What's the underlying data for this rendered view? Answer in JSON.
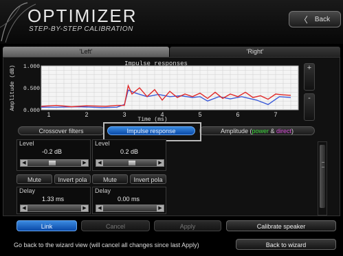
{
  "app": {
    "title": "OPTIMIZER",
    "subtitle": "STEP-BY-STEP CALIBRATION",
    "back_label": "Back"
  },
  "tabs": [
    {
      "label": "'Left'",
      "active": true
    },
    {
      "label": "'Right'",
      "active": false
    }
  ],
  "chart_data": {
    "type": "line",
    "title": "Impulse responses",
    "xlabel": "Time (ms)",
    "ylabel": "Amplitude (dB)",
    "x_ticks": [
      "1",
      "2",
      "3",
      "4",
      "5",
      "6",
      "7"
    ],
    "y_ticks": [
      "1.000",
      "0.500",
      "0.000"
    ],
    "xlim": [
      0.8,
      7.6
    ],
    "grid": true,
    "series": [
      {
        "color": "#3a5ad8",
        "points": [
          [
            0.8,
            0.06
          ],
          [
            1.2,
            0.06
          ],
          [
            1.8,
            0.07
          ],
          [
            2.4,
            0.05
          ],
          [
            2.8,
            0.06
          ],
          [
            3.0,
            0.12
          ],
          [
            3.1,
            0.45
          ],
          [
            3.3,
            0.38
          ],
          [
            3.6,
            0.3
          ],
          [
            3.9,
            0.35
          ],
          [
            4.2,
            0.3
          ],
          [
            4.5,
            0.32
          ],
          [
            4.8,
            0.28
          ],
          [
            5.0,
            0.3
          ],
          [
            5.2,
            0.2
          ],
          [
            5.5,
            0.3
          ],
          [
            5.8,
            0.25
          ],
          [
            6.1,
            0.3
          ],
          [
            6.5,
            0.22
          ],
          [
            6.8,
            0.12
          ],
          [
            7.1,
            0.3
          ],
          [
            7.4,
            0.28
          ]
        ]
      },
      {
        "color": "#e02828",
        "points": [
          [
            0.8,
            0.08
          ],
          [
            1.2,
            0.1
          ],
          [
            1.6,
            0.07
          ],
          [
            2.0,
            0.09
          ],
          [
            2.5,
            0.08
          ],
          [
            2.8,
            0.1
          ],
          [
            3.0,
            0.1
          ],
          [
            3.1,
            0.55
          ],
          [
            3.2,
            0.36
          ],
          [
            3.4,
            0.5
          ],
          [
            3.6,
            0.3
          ],
          [
            3.8,
            0.46
          ],
          [
            4.0,
            0.22
          ],
          [
            4.2,
            0.42
          ],
          [
            4.4,
            0.28
          ],
          [
            4.6,
            0.36
          ],
          [
            4.8,
            0.3
          ],
          [
            5.0,
            0.38
          ],
          [
            5.2,
            0.26
          ],
          [
            5.4,
            0.4
          ],
          [
            5.6,
            0.26
          ],
          [
            5.8,
            0.36
          ],
          [
            6.0,
            0.3
          ],
          [
            6.2,
            0.4
          ],
          [
            6.4,
            0.28
          ],
          [
            6.6,
            0.32
          ],
          [
            6.8,
            0.24
          ],
          [
            7.0,
            0.36
          ],
          [
            7.2,
            0.34
          ],
          [
            7.4,
            0.33
          ]
        ]
      }
    ]
  },
  "zoom": {
    "plus": "+",
    "minus": "-"
  },
  "modes": {
    "crossover": "Crossover filters",
    "impulse": "Impulse response",
    "amplitude_prefix": "Amplitude (",
    "amplitude_power": "power",
    "amplitude_amp": " & ",
    "amplitude_direct": "direct",
    "amplitude_suffix": ")"
  },
  "channels": [
    {
      "level_label": "Level",
      "level_value": "-0.2 dB",
      "level_fraction": 0.45,
      "mute": "Mute",
      "invert": "Invert pola",
      "delay_label": "Delay",
      "delay_value": "1.33 ms"
    },
    {
      "level_label": "Level",
      "level_value": "0.2 dB",
      "level_fraction": 0.55,
      "mute": "Mute",
      "invert": "Invert pola",
      "delay_label": "Delay",
      "delay_value": "0.00 ms"
    }
  ],
  "bottom": {
    "link": "Link",
    "cancel": "Cancel",
    "apply": "Apply",
    "calibrate": "Calibrate speaker",
    "status": "Go back to the wizard view (will cancel all changes since last Apply)",
    "wizard": "Back to wizard"
  },
  "colors": {
    "accent": "#1a6ad0",
    "series_blue": "#3a5ad8",
    "series_red": "#e02828",
    "power": "#3ad83a",
    "direct": "#d84ad8"
  }
}
